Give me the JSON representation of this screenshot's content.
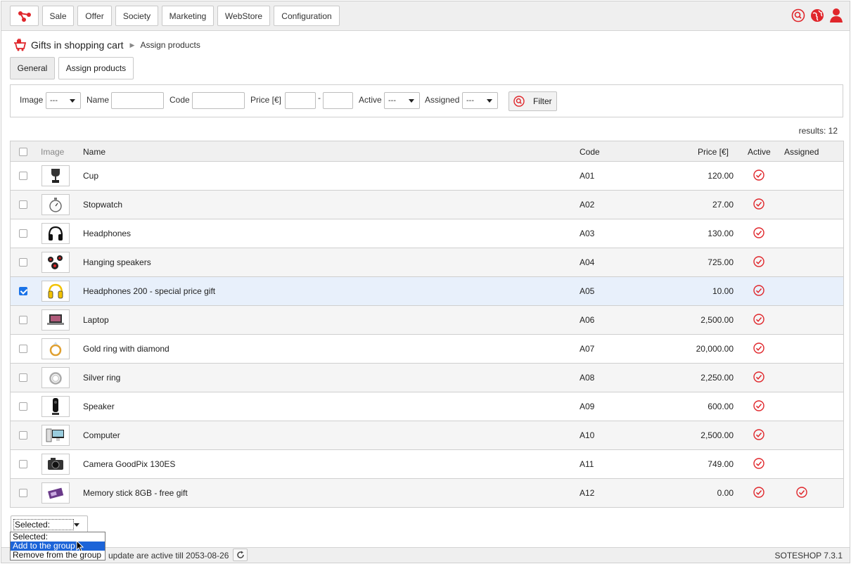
{
  "nav": [
    "Sale",
    "Offer",
    "Society",
    "Marketing",
    "WebStore",
    "Configuration"
  ],
  "breadcrumb": {
    "title": "Gifts in shopping cart",
    "sub": "Assign products"
  },
  "tabs": {
    "general": "General",
    "assign": "Assign products"
  },
  "filter": {
    "image_label": "Image",
    "image_value": "---",
    "name_label": "Name",
    "code_label": "Code",
    "price_label": "Price [€]",
    "price_sep": "-",
    "active_label": "Active",
    "active_value": "---",
    "assigned_label": "Assigned",
    "assigned_value": "---",
    "button": "Filter"
  },
  "results": "results: 12",
  "columns": {
    "image": "Image",
    "name": "Name",
    "code": "Code",
    "price": "Price [€]",
    "active": "Active",
    "assigned": "Assigned"
  },
  "rows": [
    {
      "name": "Cup",
      "code": "A01",
      "price": "120.00",
      "checked": false,
      "assigned": false,
      "icon": "cup-icon"
    },
    {
      "name": "Stopwatch",
      "code": "A02",
      "price": "27.00",
      "checked": false,
      "assigned": false,
      "icon": "stopwatch-icon"
    },
    {
      "name": "Headphones",
      "code": "A03",
      "price": "130.00",
      "checked": false,
      "assigned": false,
      "icon": "headphones-icon"
    },
    {
      "name": "Hanging speakers",
      "code": "A04",
      "price": "725.00",
      "checked": false,
      "assigned": false,
      "icon": "speakers-icon"
    },
    {
      "name": "Headphones 200 - special price gift",
      "code": "A05",
      "price": "10.00",
      "checked": true,
      "assigned": false,
      "icon": "headphones-yellow-icon"
    },
    {
      "name": "Laptop",
      "code": "A06",
      "price": "2,500.00",
      "checked": false,
      "assigned": false,
      "icon": "laptop-icon"
    },
    {
      "name": "Gold ring with diamond",
      "code": "A07",
      "price": "20,000.00",
      "checked": false,
      "assigned": false,
      "icon": "gold-ring-icon"
    },
    {
      "name": "Silver ring",
      "code": "A08",
      "price": "2,250.00",
      "checked": false,
      "assigned": false,
      "icon": "silver-ring-icon"
    },
    {
      "name": "Speaker",
      "code": "A09",
      "price": "600.00",
      "checked": false,
      "assigned": false,
      "icon": "speaker-icon"
    },
    {
      "name": "Computer",
      "code": "A10",
      "price": "2,500.00",
      "checked": false,
      "assigned": false,
      "icon": "computer-icon"
    },
    {
      "name": "Camera GoodPix 130ES",
      "code": "A11",
      "price": "749.00",
      "checked": false,
      "assigned": false,
      "icon": "camera-icon"
    },
    {
      "name": "Memory stick 8GB - free gift",
      "code": "A12",
      "price": "0.00",
      "checked": false,
      "assigned": true,
      "icon": "memory-stick-icon"
    }
  ],
  "bulk_select": {
    "value": "Selected:",
    "options": [
      "Selected:",
      "Add to the group",
      "Remove from the group"
    ]
  },
  "footer": {
    "note": "update are active till 2053-08-26",
    "version": "SOTESHOP 7.3.1"
  },
  "colors": {
    "accent": "#e0262b",
    "selection": "#1c64d8"
  }
}
